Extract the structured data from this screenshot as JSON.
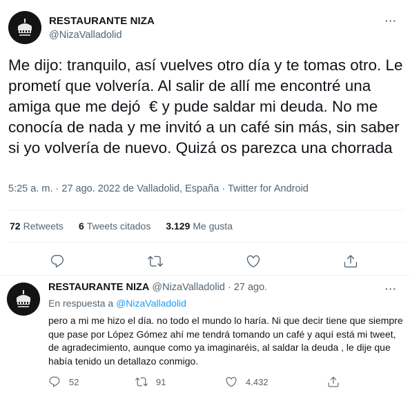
{
  "main_tweet": {
    "author_name": "RESTAURANTE NIZA",
    "author_handle": "@NizaValladolid",
    "text": "Me dijo: tranquilo, así vuelves otro día y te tomas otro. Le prometí que volvería. Al salir de allí me encontré una amiga que me dejó  € y pude saldar mi deuda. No me conocía de nada y me invitó a un café sin más, sin saber si yo volvería de nuevo. Quizá os parezca una chorrada",
    "time": "5:25 a. m.",
    "date": "27 ago. 2022",
    "location": "de Valladolid, España",
    "client": "Twitter for Android",
    "separator": "·",
    "stats": {
      "retweets_count": "72",
      "retweets_label": "Retweets",
      "quotes_count": "6",
      "quotes_label": "Tweets citados",
      "likes_count": "3.129",
      "likes_label": "Me gusta"
    }
  },
  "reply_tweet": {
    "author_name": "RESTAURANTE NIZA",
    "author_handle": "@NizaValladolid",
    "date": "27 ago.",
    "separator": "·",
    "in_reply_prefix": "En respuesta a",
    "in_reply_handle": "@NizaValladolid",
    "text": "pero a mi me hizo el día. no todo el mundo lo haría. Ni que decir tiene que siempre que pase por López Gómez ahí me tendrá tomando un café y aquí está mi tweet, de agradecimiento, aunque como ya imaginaréis, al saldar la deuda , le dije que había tenido un detallazo conmigo.",
    "replies": "52",
    "retweets": "91",
    "likes": "4.432"
  },
  "icons": [
    "reply-icon",
    "retweet-icon",
    "like-icon",
    "share-icon",
    "more-icon"
  ],
  "colors": {
    "text": "#0f1419",
    "secondary": "#536471",
    "link": "#1d9bf0",
    "divider": "#eff3f4"
  },
  "more_glyph": "···"
}
